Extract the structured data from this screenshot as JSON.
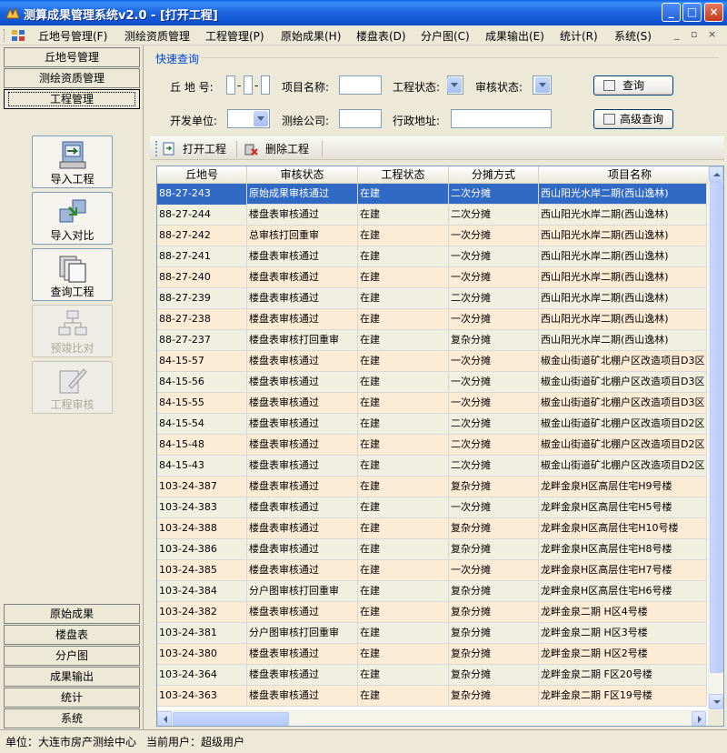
{
  "window": {
    "title": "测算成果管理系统v2.0 - [打开工程]",
    "minimize": "_",
    "maximize": "□",
    "close": "×"
  },
  "menu": {
    "items": [
      "丘地号管理(F)",
      "测绘资质管理",
      "工程管理(P)",
      "原始成果(H)",
      "楼盘表(D)",
      "分户图(C)",
      "成果输出(E)",
      "统计(R)",
      "系统(S)"
    ],
    "mdi_minimize": "_",
    "mdi_restore": "▫",
    "mdi_close": "×"
  },
  "leftnav": {
    "top_groups": [
      "丘地号管理",
      "测绘资质管理",
      "工程管理"
    ],
    "tools": [
      {
        "label": "导入工程",
        "enabled": true,
        "icon": "import-project-icon"
      },
      {
        "label": "导入对比",
        "enabled": true,
        "icon": "import-compare-icon"
      },
      {
        "label": "查询工程",
        "enabled": true,
        "icon": "query-project-icon"
      },
      {
        "label": "预竣比对",
        "enabled": false,
        "icon": "pre-completion-compare-icon"
      },
      {
        "label": "工程审核",
        "enabled": false,
        "icon": "project-review-icon"
      }
    ],
    "bottom_groups": [
      "原始成果",
      "楼盘表",
      "分户图",
      "成果输出",
      "统计",
      "系统"
    ]
  },
  "query": {
    "title": "快速查询",
    "parcel_label": "丘 地 号:",
    "parcel_sep": "-",
    "project_name_label": "项目名称:",
    "project_status_label": "工程状态:",
    "review_status_label": "审核状态:",
    "developer_label": "开发单位:",
    "survey_company_label": "测绘公司:",
    "address_label": "行政地址:",
    "query_button": "查询",
    "advanced_button": "高级查询"
  },
  "toolbar": {
    "open_project": "打开工程",
    "delete_project": "删除工程"
  },
  "grid": {
    "columns": [
      "丘地号",
      "审核状态",
      "工程状态",
      "分摊方式",
      "项目名称"
    ],
    "rows": [
      [
        "88-27-243",
        "原始成果审核通过",
        "在建",
        "二次分摊",
        "西山阳光水岸二期(西山逸林)"
      ],
      [
        "88-27-244",
        "楼盘表审核通过",
        "在建",
        "二次分摊",
        "西山阳光水岸二期(西山逸林)"
      ],
      [
        "88-27-242",
        "总审核打回重审",
        "在建",
        "一次分摊",
        "西山阳光水岸二期(西山逸林)"
      ],
      [
        "88-27-241",
        "楼盘表审核通过",
        "在建",
        "一次分摊",
        "西山阳光水岸二期(西山逸林)"
      ],
      [
        "88-27-240",
        "楼盘表审核通过",
        "在建",
        "一次分摊",
        "西山阳光水岸二期(西山逸林)"
      ],
      [
        "88-27-239",
        "楼盘表审核通过",
        "在建",
        "二次分摊",
        "西山阳光水岸二期(西山逸林)"
      ],
      [
        "88-27-238",
        "楼盘表审核通过",
        "在建",
        "一次分摊",
        "西山阳光水岸二期(西山逸林)"
      ],
      [
        "88-27-237",
        "楼盘表审核打回重审",
        "在建",
        "复杂分摊",
        "西山阳光水岸二期(西山逸林)"
      ],
      [
        "84-15-57",
        "楼盘表审核通过",
        "在建",
        "一次分摊",
        "椒金山街道矿北棚户区改造项目D3区"
      ],
      [
        "84-15-56",
        "楼盘表审核通过",
        "在建",
        "一次分摊",
        "椒金山街道矿北棚户区改造项目D3区"
      ],
      [
        "84-15-55",
        "楼盘表审核通过",
        "在建",
        "一次分摊",
        "椒金山街道矿北棚户区改造项目D3区"
      ],
      [
        "84-15-54",
        "楼盘表审核通过",
        "在建",
        "二次分摊",
        "椒金山街道矿北棚户区改造项目D2区"
      ],
      [
        "84-15-48",
        "楼盘表审核通过",
        "在建",
        "二次分摊",
        "椒金山街道矿北棚户区改造项目D2区"
      ],
      [
        "84-15-43",
        "楼盘表审核通过",
        "在建",
        "二次分摊",
        "椒金山街道矿北棚户区改造项目D2区"
      ],
      [
        "103-24-387",
        "楼盘表审核通过",
        "在建",
        "复杂分摊",
        "龙畔金泉H区高层住宅H9号楼"
      ],
      [
        "103-24-383",
        "楼盘表审核通过",
        "在建",
        "一次分摊",
        "龙畔金泉H区高层住宅H5号楼"
      ],
      [
        "103-24-388",
        "楼盘表审核通过",
        "在建",
        "复杂分摊",
        "龙畔金泉H区高层住宅H10号楼"
      ],
      [
        "103-24-386",
        "楼盘表审核通过",
        "在建",
        "复杂分摊",
        "龙畔金泉H区高层住宅H8号楼"
      ],
      [
        "103-24-385",
        "楼盘表审核通过",
        "在建",
        "一次分摊",
        "龙畔金泉H区高层住宅H7号楼"
      ],
      [
        "103-24-384",
        "分户图审核打回重审",
        "在建",
        "复杂分摊",
        "龙畔金泉H区高层住宅H6号楼"
      ],
      [
        "103-24-382",
        "楼盘表审核通过",
        "在建",
        "复杂分摊",
        "龙畔金泉二期 H区4号楼"
      ],
      [
        "103-24-381",
        "分户图审核打回重审",
        "在建",
        "复杂分摊",
        "龙畔金泉二期 H区3号楼"
      ],
      [
        "103-24-380",
        "楼盘表审核通过",
        "在建",
        "复杂分摊",
        "龙畔金泉二期 H区2号楼"
      ],
      [
        "103-24-364",
        "楼盘表审核通过",
        "在建",
        "复杂分摊",
        "龙畔金泉二期 F区20号楼"
      ],
      [
        "103-24-363",
        "楼盘表审核通过",
        "在建",
        "复杂分摊",
        "龙畔金泉二期 F区19号楼"
      ]
    ]
  },
  "status": {
    "unit": "单位：大连市房产测绘中心",
    "user": "当前用户：超级用户"
  },
  "colors": {
    "selection": "#316AC5",
    "row_odd": "#FCEBD5",
    "row_even": "#EFF0DF",
    "accent_title": "#0046D5"
  }
}
